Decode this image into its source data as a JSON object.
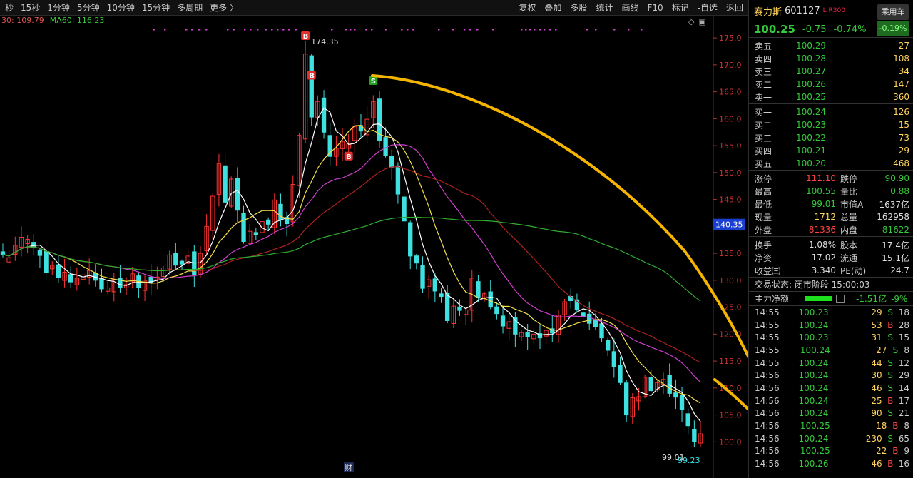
{
  "toolbar": {
    "left": [
      "秒",
      "15秒",
      "1分钟",
      "5分钟",
      "10分钟",
      "15分钟",
      "多周期",
      "更多 〉"
    ],
    "right": [
      "复权",
      "叠加",
      "多股",
      "统计",
      "画线",
      "F10",
      "标记",
      "-自选",
      "返回"
    ]
  },
  "ma_labels": {
    "ma30": "30: 109.79",
    "ma60": "MA60: 116.23"
  },
  "chart_data": {
    "type": "candlestick",
    "ylim": [
      97,
      177
    ],
    "yticks": [
      100.0,
      105.0,
      110.0,
      115.0,
      120.0,
      125.0,
      130.0,
      135.0,
      140.0,
      145.0,
      150.0,
      155.0,
      160.0,
      165.0,
      170.0,
      175.0
    ],
    "current_price_label": "140.35",
    "high_label": "174.35",
    "low_label_1": "99.01",
    "low_label_2": "99.23",
    "signal_marks": [
      "B",
      "B",
      "B",
      "S"
    ],
    "bottom_mark": "财",
    "closes": [
      134.8,
      134.2,
      136.5,
      138,
      137.6,
      136,
      134.6,
      131.4,
      132.8,
      130.5,
      131.5,
      129.7,
      130.4,
      131,
      131.8,
      130,
      128.4,
      128.6,
      130.2,
      128.7,
      129.2,
      131.2,
      128.7,
      130,
      129.5,
      130.6,
      132.3,
      134.7,
      132.8,
      133,
      134.5,
      131,
      135,
      140,
      145.6,
      151.7,
      144.5,
      148.8,
      143,
      137.2,
      139.1,
      138.4,
      140.9,
      140.4,
      144.9,
      141.3,
      140.5,
      147.8,
      156.9,
      172,
      160.3,
      163.2,
      157.5,
      153,
      154.5,
      155.8,
      155.3,
      158.5,
      157.7,
      159.9,
      163.2,
      155.9,
      153.2,
      151,
      146,
      141,
      134.5,
      133.2,
      128.5,
      130.1,
      128,
      127,
      122.5,
      125.2,
      124.4,
      124.5,
      130.4,
      126.8,
      127.5,
      125,
      123.8,
      121.5,
      122.3,
      120,
      120.3,
      119.5,
      120,
      119.3,
      120.7,
      120.2,
      123.5,
      126,
      126.2,
      124.5,
      123.3,
      122,
      121.3,
      119.3,
      117,
      114,
      111,
      105,
      108.2,
      108.4,
      112,
      109.5,
      111,
      111.6,
      109,
      108.3,
      106,
      103,
      100.1,
      101.5
    ],
    "ma_series": [
      {
        "name": "MA5",
        "color": "#ffffff"
      },
      {
        "name": "MA10",
        "color": "#f5e04a"
      },
      {
        "name": "MA20",
        "color": "#d040d0"
      },
      {
        "name": "MA30",
        "color": "#b02020"
      },
      {
        "name": "MA60",
        "color": "#2fae2f"
      }
    ]
  },
  "stock": {
    "name": "赛力斯",
    "code": "601127",
    "tag": "L R300",
    "price": "100.25",
    "change": "-0.75",
    "change_pct": "-0.74%",
    "ride_label": "乘用车",
    "ride_pct": "-0.19%"
  },
  "asks": [
    {
      "label": "卖五",
      "price": "100.29",
      "vol": "27"
    },
    {
      "label": "卖四",
      "price": "100.28",
      "vol": "108"
    },
    {
      "label": "卖三",
      "price": "100.27",
      "vol": "34"
    },
    {
      "label": "卖二",
      "price": "100.26",
      "vol": "147"
    },
    {
      "label": "卖一",
      "price": "100.25",
      "vol": "360"
    }
  ],
  "bids": [
    {
      "label": "买一",
      "price": "100.24",
      "vol": "126"
    },
    {
      "label": "买二",
      "price": "100.23",
      "vol": "15"
    },
    {
      "label": "买三",
      "price": "100.22",
      "vol": "73"
    },
    {
      "label": "买四",
      "price": "100.21",
      "vol": "29"
    },
    {
      "label": "买五",
      "price": "100.20",
      "vol": "468"
    }
  ],
  "stats1": [
    {
      "a": "涨停",
      "b": "111.10",
      "bc": "red",
      "c": "跌停",
      "d": "90.90",
      "dc": "green"
    },
    {
      "a": "最高",
      "b": "100.55",
      "bc": "green",
      "c": "量比",
      "d": "0.88",
      "dc": "green"
    },
    {
      "a": "最低",
      "b": "99.01",
      "bc": "green",
      "c": "市值A",
      "d": "1637亿",
      "dc": "white"
    },
    {
      "a": "现量",
      "b": "1712",
      "bc": "yellow",
      "c": "总量",
      "d": "162958",
      "dc": "white"
    },
    {
      "a": "外盘",
      "b": "81336",
      "bc": "red",
      "c": "内盘",
      "d": "81622",
      "dc": "green"
    }
  ],
  "stats2": [
    {
      "a": "换手",
      "b": "1.08%",
      "bc": "white",
      "c": "股本",
      "d": "17.4亿",
      "dc": "white"
    },
    {
      "a": "净资",
      "b": "17.02",
      "bc": "white",
      "c": "流通",
      "d": "15.1亿",
      "dc": "white"
    },
    {
      "a": "收益㈢",
      "b": "3.340",
      "bc": "white",
      "c": "PE(动)",
      "d": "24.7",
      "dc": "white"
    }
  ],
  "status": {
    "text": "交易状态: 闭市阶段 15:00:03"
  },
  "net": {
    "label": "主力净额",
    "value": "-1.51亿",
    "pct": "-9%"
  },
  "ticks": [
    {
      "t": "14:55",
      "p": "100.23",
      "v": "29",
      "bs": "S",
      "n": "18"
    },
    {
      "t": "14:55",
      "p": "100.24",
      "v": "53",
      "bs": "B",
      "n": "28"
    },
    {
      "t": "14:55",
      "p": "100.23",
      "v": "31",
      "bs": "S",
      "n": "15"
    },
    {
      "t": "14:55",
      "p": "100.24",
      "v": "27",
      "bs": "S",
      "n": "8"
    },
    {
      "t": "14:55",
      "p": "100.24",
      "v": "44",
      "bs": "S",
      "n": "12"
    },
    {
      "t": "14:56",
      "p": "100.24",
      "v": "30",
      "bs": "S",
      "n": "29"
    },
    {
      "t": "14:56",
      "p": "100.24",
      "v": "46",
      "bs": "S",
      "n": "14"
    },
    {
      "t": "14:56",
      "p": "100.24",
      "v": "25",
      "bs": "B",
      "n": "17"
    },
    {
      "t": "14:56",
      "p": "100.24",
      "v": "90",
      "bs": "S",
      "n": "21"
    },
    {
      "t": "14:56",
      "p": "100.25",
      "v": "18",
      "bs": "B",
      "n": "8"
    },
    {
      "t": "14:56",
      "p": "100.24",
      "v": "230",
      "bs": "S",
      "n": "65"
    },
    {
      "t": "14:56",
      "p": "100.25",
      "v": "22",
      "bs": "B",
      "n": "9"
    },
    {
      "t": "14:56",
      "p": "100.26",
      "v": "46",
      "bs": "B",
      "n": "16"
    }
  ]
}
